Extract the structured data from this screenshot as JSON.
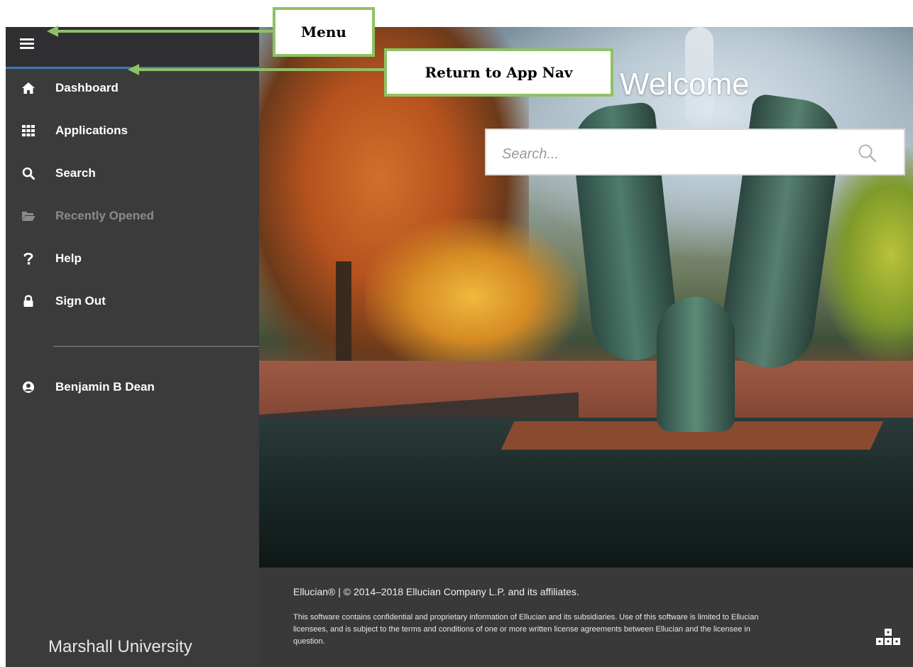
{
  "header": {
    "menu_icon": "hamburger-menu-icon"
  },
  "sidebar": {
    "items": [
      {
        "label": "Dashboard",
        "icon": "home-icon"
      },
      {
        "label": "Applications",
        "icon": "grid-icon"
      },
      {
        "label": "Search",
        "icon": "search-icon"
      },
      {
        "label": "Recently Opened",
        "icon": "folder-icon",
        "disabled": true
      },
      {
        "label": "Help",
        "icon": "question-icon"
      },
      {
        "label": "Sign Out",
        "icon": "lock-icon"
      }
    ],
    "user": {
      "name": "Benjamin B Dean",
      "icon": "user-circle-icon"
    },
    "org_name": "Marshall University"
  },
  "main": {
    "welcome": "Welcome",
    "search": {
      "placeholder": "Search..."
    }
  },
  "footer": {
    "copyright": "Ellucian® | © 2014–2018 Ellucian Company L.P. and its affiliates.",
    "legal": "This software contains confidential and proprietary information of Ellucian and its subsidiaries. Use of this software is limited to Ellucian licensees, and is subject to the terms and conditions of one or more written license agreements between Ellucian and the licensee in question.",
    "logo_icon": "ellucian-logo-icon"
  },
  "annotations": {
    "menu": "Menu",
    "return": "Return to App Nav",
    "color": "#8ec165"
  },
  "colors": {
    "sidebar": "#3b3b3b",
    "accent": "#3c78b4",
    "footer": "#393939"
  }
}
